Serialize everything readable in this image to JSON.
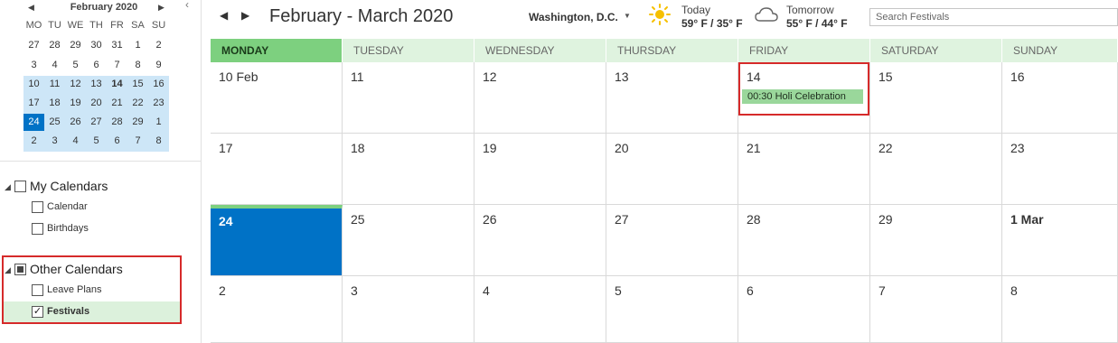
{
  "mini_calendar": {
    "month_label": "February 2020",
    "weekday_headers": [
      "MO",
      "TU",
      "WE",
      "TH",
      "FR",
      "SA",
      "SU"
    ],
    "weeks": [
      [
        "27",
        "28",
        "29",
        "30",
        "31",
        "1",
        "2"
      ],
      [
        "3",
        "4",
        "5",
        "6",
        "7",
        "8",
        "9"
      ],
      [
        "10",
        "11",
        "12",
        "13",
        "14",
        "15",
        "16"
      ],
      [
        "17",
        "18",
        "19",
        "20",
        "21",
        "22",
        "23"
      ],
      [
        "24",
        "25",
        "26",
        "27",
        "28",
        "29",
        "1"
      ],
      [
        "2",
        "3",
        "4",
        "5",
        "6",
        "7",
        "8"
      ]
    ],
    "today": "24",
    "prev_icon": "triangle-left-icon",
    "next_icon": "triangle-right-icon"
  },
  "calendars": {
    "my_calendars": {
      "label": "My Calendars",
      "items": [
        {
          "label": "Calendar",
          "checked": false
        },
        {
          "label": "Birthdays",
          "checked": false
        }
      ]
    },
    "other_calendars": {
      "label": "Other Calendars",
      "items": [
        {
          "label": "Leave Plans",
          "checked": false
        },
        {
          "label": "Festivals",
          "checked": true
        }
      ]
    }
  },
  "header": {
    "range_title": "February - March 2020",
    "location": "Washington, D.C.",
    "weather": {
      "today": {
        "label": "Today",
        "temps": "59° F / 35° F",
        "icon": "sun-icon"
      },
      "tomorrow": {
        "label": "Tomorrow",
        "temps": "55° F / 44° F",
        "icon": "cloud-icon"
      }
    },
    "search_placeholder": "Search Festivals"
  },
  "month_view": {
    "weekdays": [
      "MONDAY",
      "TUESDAY",
      "WEDNESDAY",
      "THURSDAY",
      "FRIDAY",
      "SATURDAY",
      "SUNDAY"
    ],
    "weeks": [
      [
        "10 Feb",
        "11",
        "12",
        "13",
        "14",
        "15",
        "16"
      ],
      [
        "17",
        "18",
        "19",
        "20",
        "21",
        "22",
        "23"
      ],
      [
        "24",
        "25",
        "26",
        "27",
        "28",
        "29",
        "1 Mar"
      ],
      [
        "2",
        "3",
        "4",
        "5",
        "6",
        "7",
        "8"
      ]
    ],
    "events": [
      {
        "day": "14",
        "label": "00:30 Holi Celebration"
      }
    ]
  },
  "colors": {
    "accent_blue": "#0072c6",
    "header_green": "#7dd07f",
    "light_green": "#dff3df",
    "event_green": "#9ad79b",
    "highlight_red": "#d62a2a"
  }
}
